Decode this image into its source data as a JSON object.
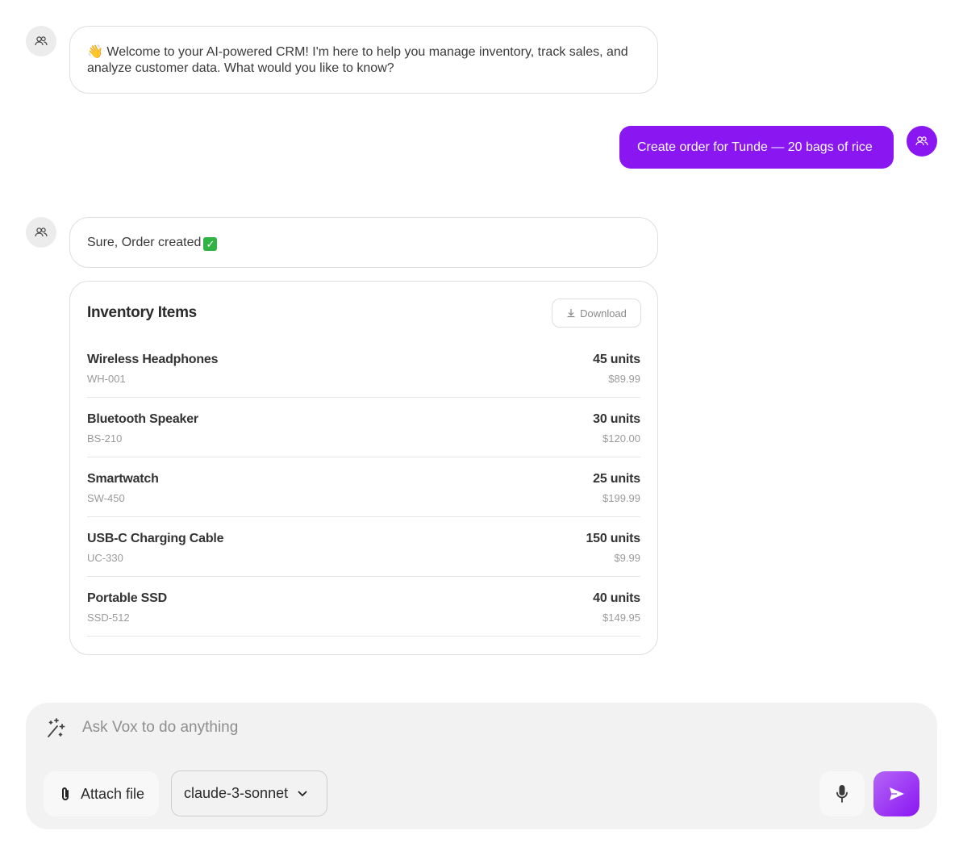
{
  "conversation": {
    "welcome_emoji": "👋",
    "welcome_text": "Welcome to your AI-powered CRM! I'm here to help you manage inventory, track sales, and analyze customer data. What would you like to know?",
    "user_message": "Create order for Tunde — 20 bags of rice",
    "reply_text": "Sure, Order created",
    "reply_check": "✓"
  },
  "inventory_card": {
    "title": "Inventory Items",
    "download_label": "Download",
    "items": [
      {
        "name": "Wireless Headphones",
        "sku": "WH-001",
        "units": "45 units",
        "price": "$89.99"
      },
      {
        "name": "Bluetooth Speaker",
        "sku": "BS-210",
        "units": "30 units",
        "price": "$120.00"
      },
      {
        "name": "Smartwatch",
        "sku": "SW-450",
        "units": "25 units",
        "price": "$199.99"
      },
      {
        "name": "USB-C Charging Cable",
        "sku": "UC-330",
        "units": "150 units",
        "price": "$9.99"
      },
      {
        "name": "Portable SSD",
        "sku": "SSD-512",
        "units": "40 units",
        "price": "$149.95"
      }
    ]
  },
  "composer": {
    "placeholder": "Ask Vox to do anything",
    "attach_label": "Attach file",
    "model": "claude-3-sonnet"
  },
  "icons": {
    "assistant_avatar": "users-icon",
    "user_avatar": "users-icon",
    "download": "download-icon",
    "magic": "magic-wand-icon",
    "attach": "paperclip-icon",
    "model_dropdown": "chevron-down-icon",
    "mic": "microphone-icon",
    "send": "send-icon"
  },
  "colors": {
    "accent": "#8a16f2",
    "check": "#2fb344"
  }
}
